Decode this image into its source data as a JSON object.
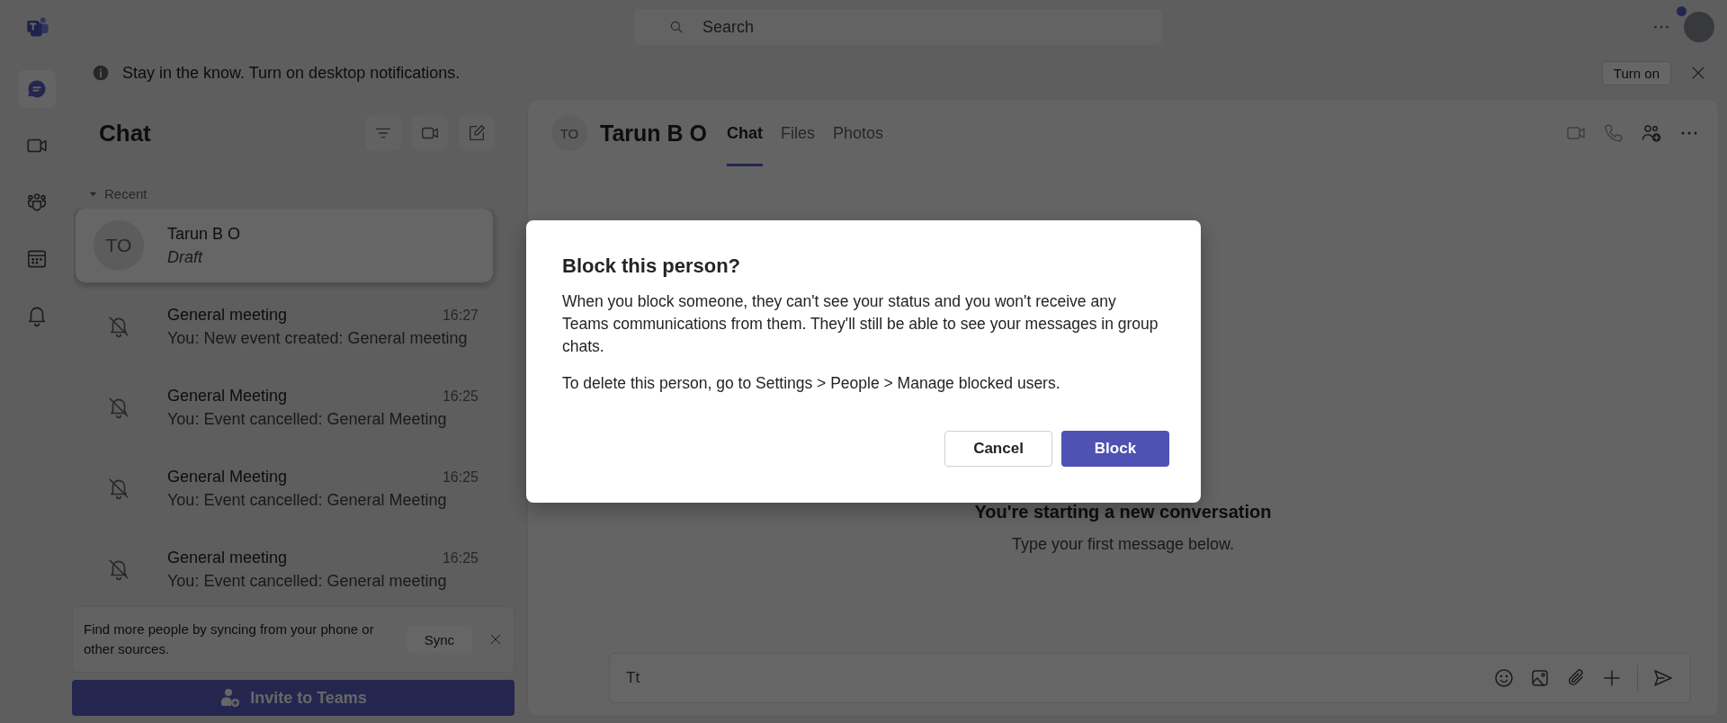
{
  "title_bar": {
    "search_placeholder": "Search"
  },
  "rail": {
    "items": [
      {
        "kind": "chat",
        "selected": true
      },
      {
        "kind": "video",
        "selected": false
      },
      {
        "kind": "people",
        "selected": false
      },
      {
        "kind": "calendar",
        "selected": false
      },
      {
        "kind": "bell",
        "selected": false
      }
    ]
  },
  "notification_bar": {
    "message": "Stay in the know. Turn on desktop notifications.",
    "button": "Turn on"
  },
  "chat_list": {
    "title": "Chat",
    "section": "Recent",
    "section_expanded": true,
    "chats": [
      {
        "kind": "person",
        "initials": "TO",
        "name": "Tarun B O",
        "preview": "Draft",
        "draft": true,
        "selected": true
      },
      {
        "kind": "meeting",
        "name": "General meeting",
        "preview": "You: New event created: General meeting",
        "time": "16:27",
        "draft": false,
        "selected": false
      },
      {
        "kind": "meeting",
        "name": "General Meeting",
        "preview": "You: Event cancelled: General Meeting",
        "time": "16:25",
        "draft": false,
        "selected": false
      },
      {
        "kind": "meeting",
        "name": "General Meeting",
        "preview": "You: Event cancelled: General Meeting",
        "time": "16:25",
        "draft": false,
        "selected": false
      },
      {
        "kind": "meeting",
        "name": "General meeting",
        "preview": "You: Event cancelled: General meeting",
        "time": "16:25",
        "draft": false,
        "selected": false
      }
    ]
  },
  "sync_card": {
    "message": "Find more people by syncing from your phone or other sources.",
    "button": "Sync"
  },
  "invite_button": "Invite to Teams",
  "conversation": {
    "initials": "TO",
    "name": "Tarun B O",
    "tabs": [
      {
        "label": "Chat",
        "selected": true
      },
      {
        "label": "Files",
        "selected": false
      },
      {
        "label": "Photos",
        "selected": false
      }
    ],
    "empty_title": "You're starting a new conversation",
    "empty_subtitle": "Type your first message below.",
    "compose": {
      "format_label": "Tt"
    }
  },
  "dialog": {
    "title": "Block this person?",
    "paragraphs": [
      "When you block someone, they can't see your status and you won't receive any Teams communications from them. They'll still be able to see your messages in group chats.",
      "To delete this person, go to Settings > People > Manage blocked users."
    ],
    "buttons": [
      {
        "label": "Cancel",
        "kind": "secondary"
      },
      {
        "label": "Block",
        "kind": "primary"
      }
    ]
  }
}
